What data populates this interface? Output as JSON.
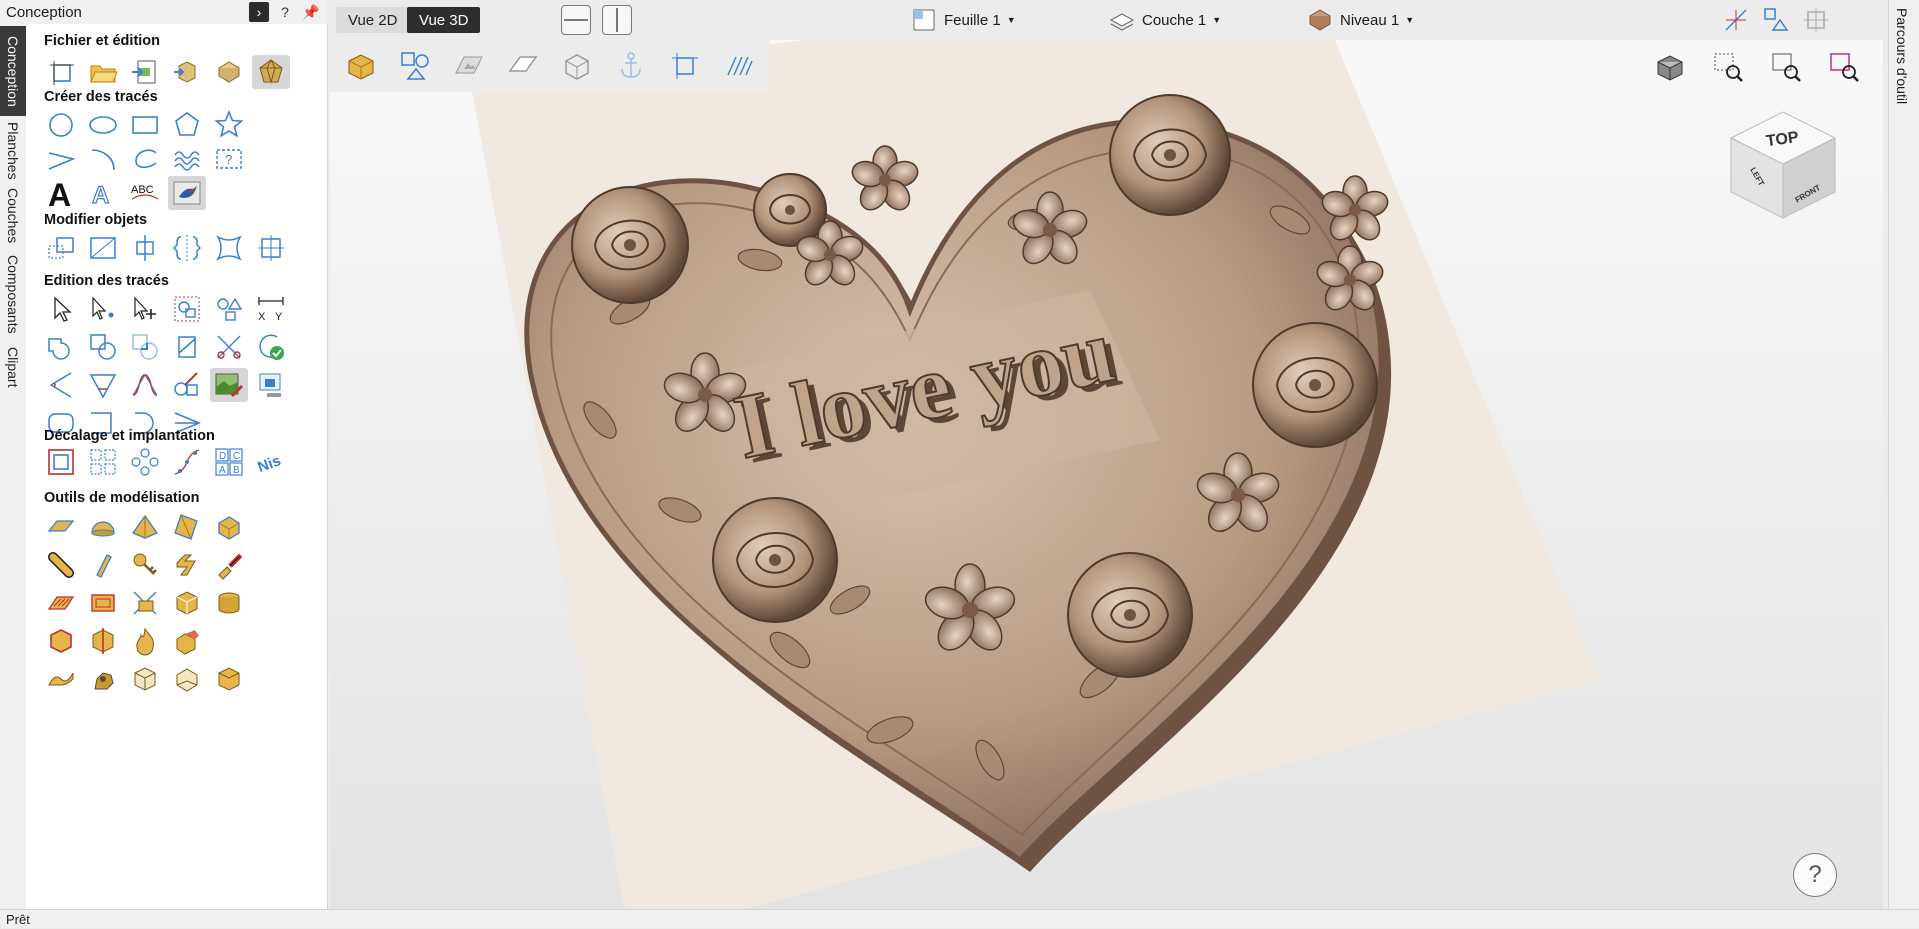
{
  "panel": {
    "title": "Conception",
    "pin_label": "?",
    "vertical_tabs": [
      "Conception",
      "Planches",
      "Couches",
      "Composants",
      "Clipart"
    ],
    "sections": {
      "file": "Fichier et édition",
      "draw": "Créer des tracés",
      "modify": "Modifier objets",
      "edit": "Edition des tracés",
      "offset": "Décalage et implantation",
      "modeling": "Outils de modélisation"
    },
    "text_tool_letter": "A",
    "text_tool_arc": "ABC",
    "xy_labels": [
      "X",
      "Y"
    ],
    "letter_grid": [
      "D",
      "C",
      "A",
      "B"
    ],
    "nest_letters": "Nis"
  },
  "topbar": {
    "view_2d": "Vue 2D",
    "view_3d": "Vue 3D",
    "sheet": "Feuille 1",
    "layer": "Couche 1",
    "level": "Niveau 1"
  },
  "viewport": {
    "relief_text": "I love you",
    "nav_cube": {
      "top": "TOP",
      "left": "LEFT",
      "front": "FRONT"
    },
    "help": "?"
  },
  "right_tab": "Parcours d'outil",
  "status": "Prêt",
  "colors": {
    "accent_blue": "#3b7fd4",
    "relief_wood": "#b89a82",
    "relief_shadow": "#5e4636",
    "board": "#f1e8df",
    "dark_toggle": "#2e2e2e"
  }
}
